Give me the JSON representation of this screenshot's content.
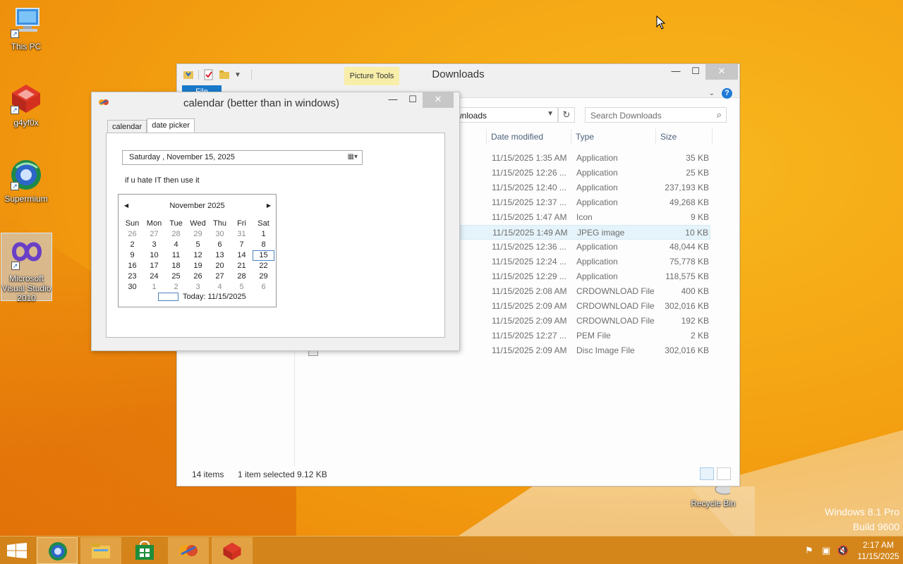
{
  "desktop": {
    "icons": [
      {
        "label": "This PC"
      },
      {
        "label": "g4yf0x"
      },
      {
        "label": "Supermium"
      },
      {
        "label": "Microsoft Visual Studio 2010"
      },
      {
        "label": "Recycle Bin"
      }
    ],
    "watermark_line1": "Windows 8.1 Pro",
    "watermark_line2": "Build 9600"
  },
  "explorer": {
    "title": "Downloads",
    "contextual_tab": "Picture Tools",
    "file_tab": "File",
    "address_text": "wnloads",
    "search_placeholder": "Search Downloads",
    "columns": {
      "date": "Date modified",
      "type": "Type",
      "size": "Size"
    },
    "files": [
      {
        "date": "11/15/2025 1:35 AM",
        "type": "Application",
        "size": "35 KB"
      },
      {
        "date": "11/15/2025 12:26 ...",
        "type": "Application",
        "size": "25 KB"
      },
      {
        "date": "11/15/2025 12:40 ...",
        "type": "Application",
        "size": "237,193 KB"
      },
      {
        "date": "11/15/2025 12:37 ...",
        "type": "Application",
        "size": "49,268 KB"
      },
      {
        "date": "11/15/2025 1:47 AM",
        "type": "Icon",
        "size": "9 KB"
      },
      {
        "date": "11/15/2025 1:49 AM",
        "type": "JPEG image",
        "size": "10 KB",
        "selected": true
      },
      {
        "date": "11/15/2025 12:36 ...",
        "type": "Application",
        "size": "48,044 KB"
      },
      {
        "date": "11/15/2025 12:24 ...",
        "type": "Application",
        "size": "75,778 KB"
      },
      {
        "date": "11/15/2025 12:29 ...",
        "type": "Application",
        "size": "118,575 KB"
      },
      {
        "date": "11/15/2025 2:08 AM",
        "type": "CRDOWNLOAD File",
        "size": "400 KB"
      },
      {
        "date": "11/15/2025 2:09 AM",
        "type": "CRDOWNLOAD File",
        "size": "302,016 KB"
      },
      {
        "date": "11/15/2025 2:09 AM",
        "type": "CRDOWNLOAD File",
        "size": "192 KB"
      },
      {
        "date": "11/15/2025 12:27 ...",
        "type": "PEM File",
        "size": "2 KB"
      },
      {
        "date": "11/15/2025 2:09 AM",
        "type": "Disc Image File",
        "size": "302,016 KB"
      }
    ],
    "status_items": "14 items",
    "status_selected": "1 item selected  9.12 KB"
  },
  "calendar_app": {
    "title": "calendar (better than in windows)",
    "tabs": [
      "calendar",
      "date picker"
    ],
    "date_value": "Saturday   , November 15, 2025",
    "hint": "if u hate IT then use it",
    "month_label": "November 2025",
    "weekdays": [
      "Sun",
      "Mon",
      "Tue",
      "Wed",
      "Thu",
      "Fri",
      "Sat"
    ],
    "weeks": [
      [
        "26",
        "27",
        "28",
        "29",
        "30",
        "31",
        "1"
      ],
      [
        "2",
        "3",
        "4",
        "5",
        "6",
        "7",
        "8"
      ],
      [
        "9",
        "10",
        "11",
        "12",
        "13",
        "14",
        "15"
      ],
      [
        "16",
        "17",
        "18",
        "19",
        "20",
        "21",
        "22"
      ],
      [
        "23",
        "24",
        "25",
        "26",
        "27",
        "28",
        "29"
      ],
      [
        "30",
        "1",
        "2",
        "3",
        "4",
        "5",
        "6"
      ]
    ],
    "today_label": "Today: 11/15/2025"
  },
  "taskbar": {
    "time": "2:17 AM",
    "date": "11/15/2025"
  }
}
